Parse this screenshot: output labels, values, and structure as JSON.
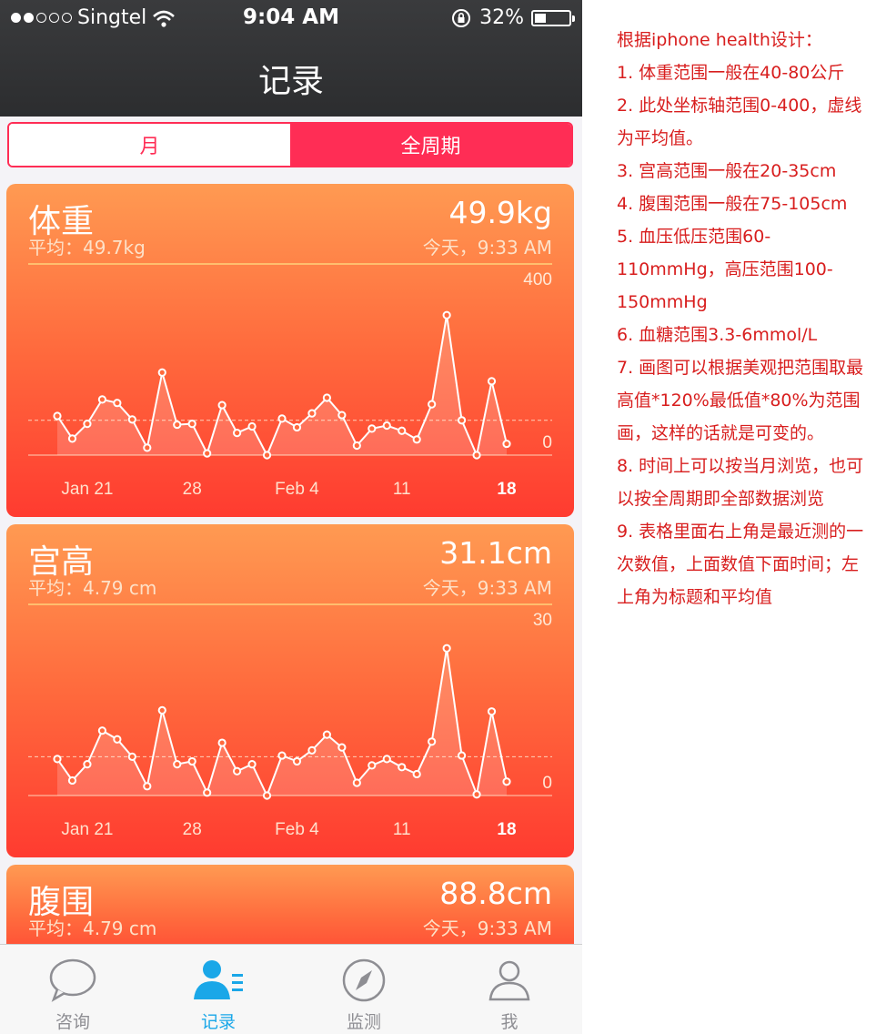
{
  "status_bar": {
    "carrier": "Singtel",
    "time": "9:04 AM",
    "battery": "32%",
    "battery_level": 0.32
  },
  "nav": {
    "title": "记录"
  },
  "segment": {
    "month": "月",
    "all": "全周期"
  },
  "cards": [
    {
      "title": "体重",
      "value": "49.9kg",
      "avg": "平均：49.7kg",
      "when": "今天，9:33 AM",
      "y_top": "400",
      "y_bottom": "0",
      "x_ticks": [
        "Jan 21",
        "28",
        "Feb 4",
        "11",
        "18"
      ]
    },
    {
      "title": "宫高",
      "value": "31.1cm",
      "avg": "平均：4.79 cm",
      "when": "今天，9:33 AM",
      "y_top": "30",
      "y_bottom": "0",
      "x_ticks": [
        "Jan 21",
        "28",
        "Feb 4",
        "11",
        "18"
      ]
    },
    {
      "title": "腹围",
      "value": "88.8cm",
      "avg": "平均：4.79 cm",
      "when": "今天，9:33 AM"
    }
  ],
  "tabbar": {
    "consult": "咨询",
    "records": "记录",
    "monitor": "监测",
    "me": "我"
  },
  "notes": [
    "根据iphone health设计：",
    "1. 体重范围一般在40-80公斤",
    "2. 此处坐标轴范围0-400，虚线为平均值。",
    "3. 宫高范围一般在20-35cm",
    "4. 腹围范围一般在75-105cm",
    "5. 血压低压范围60-110mmHg，高压范围100-150mmHg",
    "6. 血糖范围3.3-6mmol/L",
    "7. 画图可以根据美观把范围取最高值*120%最低值*80%为范围画，这样的话就是可变的。",
    "8. 时间上可以按当月浏览，也可以按全周期即全部数据浏览",
    "9. 表格里面右上角是最近测的一次数值，上面数值下面时间；左上角为标题和平均值"
  ],
  "chart_data": [
    {
      "type": "line",
      "title": "体重",
      "ylim": [
        0,
        400
      ],
      "x": [
        "Jan 19",
        "Jan 20",
        "Jan 21",
        "Jan 22",
        "Jan 23",
        "Jan 24",
        "Jan 25",
        "Jan 26",
        "Jan 27",
        "Jan 28",
        "Jan 29",
        "Jan 30",
        "Jan 31",
        "Feb 1",
        "Feb 2",
        "Feb 3",
        "Feb 4",
        "Feb 5",
        "Feb 6",
        "Feb 7",
        "Feb 8",
        "Feb 9",
        "Feb 10",
        "Feb 11",
        "Feb 12",
        "Feb 13",
        "Feb 14",
        "Feb 15",
        "Feb 16",
        "Feb 17",
        "Feb 18"
      ],
      "values": [
        90,
        38,
        72,
        128,
        120,
        82,
        17,
        190,
        70,
        72,
        4,
        115,
        51,
        66,
        0,
        84,
        64,
        96,
        132,
        92,
        22,
        61,
        68,
        56,
        36,
        117,
        322,
        80,
        0,
        170,
        26
      ],
      "average": 80
    },
    {
      "type": "line",
      "title": "宫高",
      "ylim": [
        0,
        30
      ],
      "x": [
        "Jan 19",
        "Jan 20",
        "Jan 21",
        "Jan 22",
        "Jan 23",
        "Jan 24",
        "Jan 25",
        "Jan 26",
        "Jan 27",
        "Jan 28",
        "Jan 29",
        "Jan 30",
        "Jan 31",
        "Feb 1",
        "Feb 2",
        "Feb 3",
        "Feb 4",
        "Feb 5",
        "Feb 6",
        "Feb 7",
        "Feb 8",
        "Feb 9",
        "Feb 10",
        "Feb 11",
        "Feb 12",
        "Feb 13",
        "Feb 14",
        "Feb 15",
        "Feb 16",
        "Feb 17",
        "Feb 18"
      ],
      "values": [
        6.3,
        2.6,
        5.4,
        11.2,
        9.7,
        6.7,
        1.6,
        14.7,
        5.4,
        5.9,
        0.5,
        9.1,
        4.2,
        5.4,
        0,
        6.9,
        5.9,
        7.8,
        10.5,
        8.3,
        2.2,
        5.2,
        6.3,
        4.9,
        3.7,
        9.3,
        25.4,
        6.9,
        0.2,
        14.5,
        2.4
      ],
      "average": 6.7
    }
  ]
}
